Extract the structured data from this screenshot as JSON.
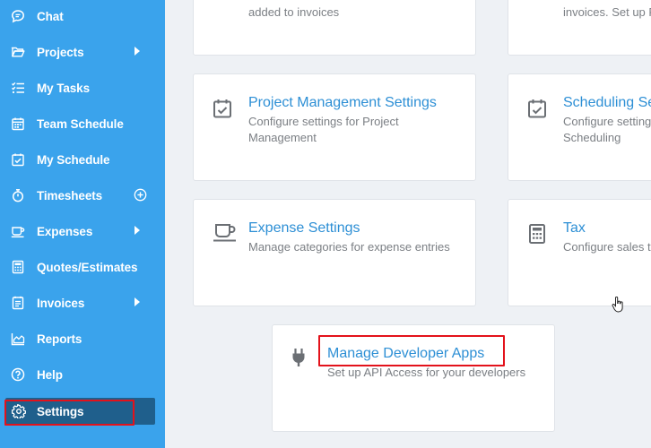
{
  "sidebar": {
    "items": [
      {
        "label": "Chat"
      },
      {
        "label": "Projects"
      },
      {
        "label": "My Tasks"
      },
      {
        "label": "Team Schedule"
      },
      {
        "label": "My Schedule"
      },
      {
        "label": "Timesheets"
      },
      {
        "label": "Expenses"
      },
      {
        "label": "Quotes/Estimates"
      },
      {
        "label": "Invoices"
      },
      {
        "label": "Reports"
      },
      {
        "label": "Help"
      },
      {
        "label": "Settings"
      }
    ]
  },
  "cards": {
    "top_left_desc": "added to invoices",
    "top_right_desc": "invoices. Set up P",
    "project_management": {
      "title": "Project Management Settings",
      "desc1": "Configure settings for Project",
      "desc2": "Management"
    },
    "scheduling": {
      "title": "Scheduling Se",
      "desc1": "Configure setting",
      "desc2": "Scheduling"
    },
    "expense": {
      "title": "Expense Settings",
      "desc1": "Manage categories for expense entries"
    },
    "tax": {
      "title": "Tax",
      "desc1": "Configure sales ta"
    },
    "developer_apps": {
      "title": "Manage Developer Apps",
      "desc1": "Set up API Access for your developers"
    }
  },
  "colors": {
    "sidebar_bg": "#3aa3ec",
    "active_bg": "#1f5f8c",
    "title_blue": "#2d8fd5",
    "highlight_red": "#e3121b"
  }
}
